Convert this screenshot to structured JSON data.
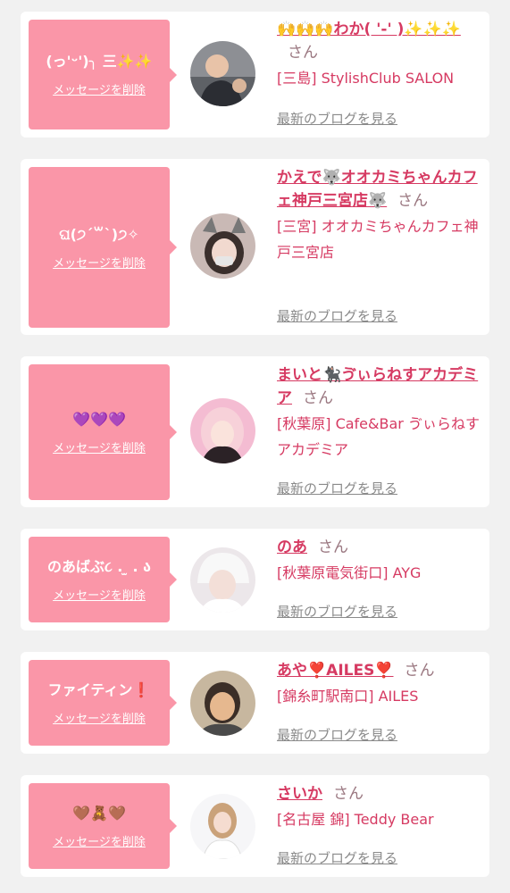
{
  "cards": [
    {
      "message": "(っ'ᵕ')╮ 三✨✨",
      "delete_label": "メッセージを削除",
      "name": "🙌🙌🙌わか(  '-' )✨✨✨",
      "san": "さん",
      "shop": "[三島] StylishClub SALON",
      "blog_label": "最新のブログを見る",
      "avatar": "avatar-1"
    },
    {
      "message": "ଘ(੭ˊ꒳ˋ)੭✧",
      "delete_label": "メッセージを削除",
      "name": "かえで🐺オオカミちゃんカフェ神戸三宮店🐺",
      "san": "さん",
      "shop": "[三宮] オオカミちゃんカフェ神戸三宮店",
      "blog_label": "最新のブログを見る",
      "avatar": "avatar-2"
    },
    {
      "message": "💜💜💜",
      "delete_label": "メッセージを削除",
      "name": "まいと🐈‍⬛ゔぃらねすアカデミア",
      "san": "さん",
      "shop": "[秋葉原] Cafe&Bar ゔぃらねすアカデミア",
      "blog_label": "最新のブログを見る",
      "avatar": "avatar-3"
    },
    {
      "message": "のあばぶ૮ . ̫ . ა",
      "delete_label": "メッセージを削除",
      "name": "のあ",
      "san": "さん",
      "shop": "[秋葉原電気街口] AYG",
      "blog_label": "最新のブログを見る",
      "avatar": "avatar-4"
    },
    {
      "message": "ファイティン❗️",
      "delete_label": "メッセージを削除",
      "name": "あや❣️AILES❣️",
      "san": "さん",
      "shop": "[錦糸町駅南口] AILES",
      "blog_label": "最新のブログを見る",
      "avatar": "avatar-5"
    },
    {
      "message": "🤎🧸🤎",
      "delete_label": "メッセージを削除",
      "name": "さいか",
      "san": "さん",
      "shop": "[名古屋 錦] Teddy Bear",
      "blog_label": "最新のブログを見る",
      "avatar": "avatar-6"
    }
  ]
}
